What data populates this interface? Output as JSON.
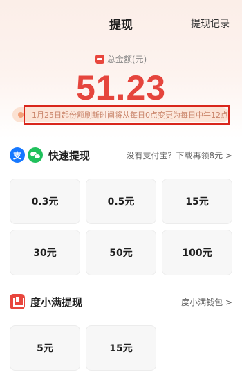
{
  "header": {
    "title": "提现",
    "records_link": "提现记录"
  },
  "balance": {
    "label": "总金额(元)",
    "amount": "51.23"
  },
  "notice": "1月25日起份额刷新时间将从每日0点变更为每日中午12点",
  "fast_withdraw": {
    "title": "快速提现",
    "link": "没有支付宝？下载再领8元 >",
    "alipay_glyph": "支",
    "options": [
      "0.3元",
      "0.5元",
      "15元",
      "30元",
      "50元",
      "100元"
    ]
  },
  "duxiaoman": {
    "title": "度小满提现",
    "link": "度小满钱包 >",
    "options": [
      "5元",
      "15元"
    ]
  },
  "colors": {
    "accent": "#e5453d",
    "alipay": "#1678ff",
    "wechat": "#20c05c",
    "highlight_border": "#d9261c"
  },
  "icons": [
    "wallet-icon",
    "notice-icon",
    "alipay-icon",
    "wechat-icon",
    "duxiaoman-icon"
  ]
}
